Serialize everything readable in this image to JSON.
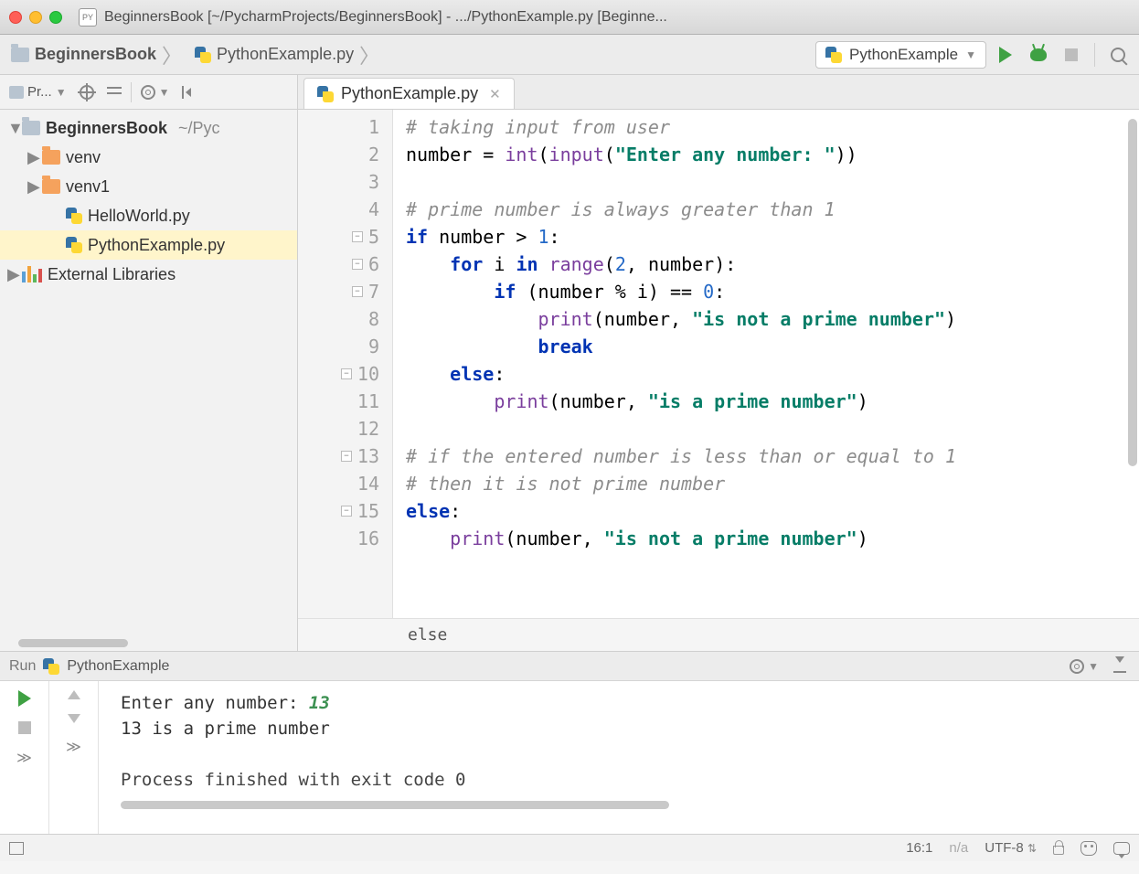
{
  "title": "BeginnersBook [~/PycharmProjects/BeginnersBook] - .../PythonExample.py [Beginne...",
  "breadcrumb": {
    "project": "BeginnersBook",
    "file": "PythonExample.py"
  },
  "runConfig": "PythonExample",
  "sidebar": {
    "toolLabel": "Pr...",
    "root": {
      "name": "BeginnersBook",
      "path": "~/Pyc"
    },
    "items": [
      {
        "name": "venv",
        "type": "dir"
      },
      {
        "name": "venv1",
        "type": "dir"
      },
      {
        "name": "HelloWorld.py",
        "type": "py"
      },
      {
        "name": "PythonExample.py",
        "type": "py",
        "selected": true
      }
    ],
    "external": "External Libraries"
  },
  "editor": {
    "tab": "PythonExample.py",
    "lines": [
      {
        "n": 1,
        "tokens": [
          [
            "c",
            "# taking input from user"
          ]
        ]
      },
      {
        "n": 2,
        "tokens": [
          [
            "b",
            "number = "
          ],
          [
            "bi",
            "int"
          ],
          [
            "b",
            "("
          ],
          [
            "bi",
            "input"
          ],
          [
            "b",
            "("
          ],
          [
            "s",
            "\"Enter any number: \""
          ],
          [
            "b",
            "))"
          ]
        ]
      },
      {
        "n": 3,
        "tokens": []
      },
      {
        "n": 4,
        "tokens": [
          [
            "c",
            "# prime number is always greater than 1"
          ]
        ]
      },
      {
        "n": 5,
        "fold": true,
        "tokens": [
          [
            "k",
            "if "
          ],
          [
            "b",
            "number > "
          ],
          [
            "n",
            "1"
          ],
          [
            "b",
            ":"
          ]
        ]
      },
      {
        "n": 6,
        "fold": true,
        "tokens": [
          [
            "b",
            "    "
          ],
          [
            "k",
            "for "
          ],
          [
            "b",
            "i "
          ],
          [
            "k",
            "in "
          ],
          [
            "bi",
            "range"
          ],
          [
            "b",
            "("
          ],
          [
            "n",
            "2"
          ],
          [
            "b",
            ", number):"
          ]
        ]
      },
      {
        "n": 7,
        "fold": true,
        "tokens": [
          [
            "b",
            "        "
          ],
          [
            "k",
            "if "
          ],
          [
            "b",
            "(number % i) == "
          ],
          [
            "n",
            "0"
          ],
          [
            "b",
            ":"
          ]
        ]
      },
      {
        "n": 8,
        "tokens": [
          [
            "b",
            "            "
          ],
          [
            "bi",
            "print"
          ],
          [
            "b",
            "(number, "
          ],
          [
            "s",
            "\"is not a prime number\""
          ],
          [
            "b",
            ")"
          ]
        ]
      },
      {
        "n": 9,
        "tokens": [
          [
            "b",
            "            "
          ],
          [
            "k",
            "break"
          ]
        ]
      },
      {
        "n": 10,
        "fold": true,
        "tokens": [
          [
            "b",
            "    "
          ],
          [
            "k",
            "else"
          ],
          [
            "b",
            ":"
          ]
        ]
      },
      {
        "n": 11,
        "tokens": [
          [
            "b",
            "        "
          ],
          [
            "bi",
            "print"
          ],
          [
            "b",
            "(number, "
          ],
          [
            "s",
            "\"is a prime number\""
          ],
          [
            "b",
            ")"
          ]
        ]
      },
      {
        "n": 12,
        "tokens": []
      },
      {
        "n": 13,
        "fold": true,
        "tokens": [
          [
            "c",
            "# if the entered number is less than or equal to 1"
          ]
        ]
      },
      {
        "n": 14,
        "tokens": [
          [
            "c",
            "# then it is not prime number"
          ]
        ]
      },
      {
        "n": 15,
        "fold": true,
        "tokens": [
          [
            "k",
            "else"
          ],
          [
            "b",
            ":"
          ]
        ]
      },
      {
        "n": 16,
        "hl": true,
        "tokens": [
          [
            "b",
            "    "
          ],
          [
            "bi",
            "print"
          ],
          [
            "b",
            "(number, "
          ],
          [
            "s",
            "\"is not a prime number\""
          ],
          [
            "b",
            ")"
          ]
        ]
      }
    ],
    "breadcrumb": "else"
  },
  "run": {
    "panelLabel": "Run",
    "configName": "PythonExample",
    "console": {
      "promptPrefix": "Enter any number: ",
      "input": "13",
      "output": "13 is a prime number",
      "exit": "Process finished with exit code 0"
    }
  },
  "status": {
    "cursor": "16:1",
    "inspections": "n/a",
    "encoding": "UTF-8"
  }
}
